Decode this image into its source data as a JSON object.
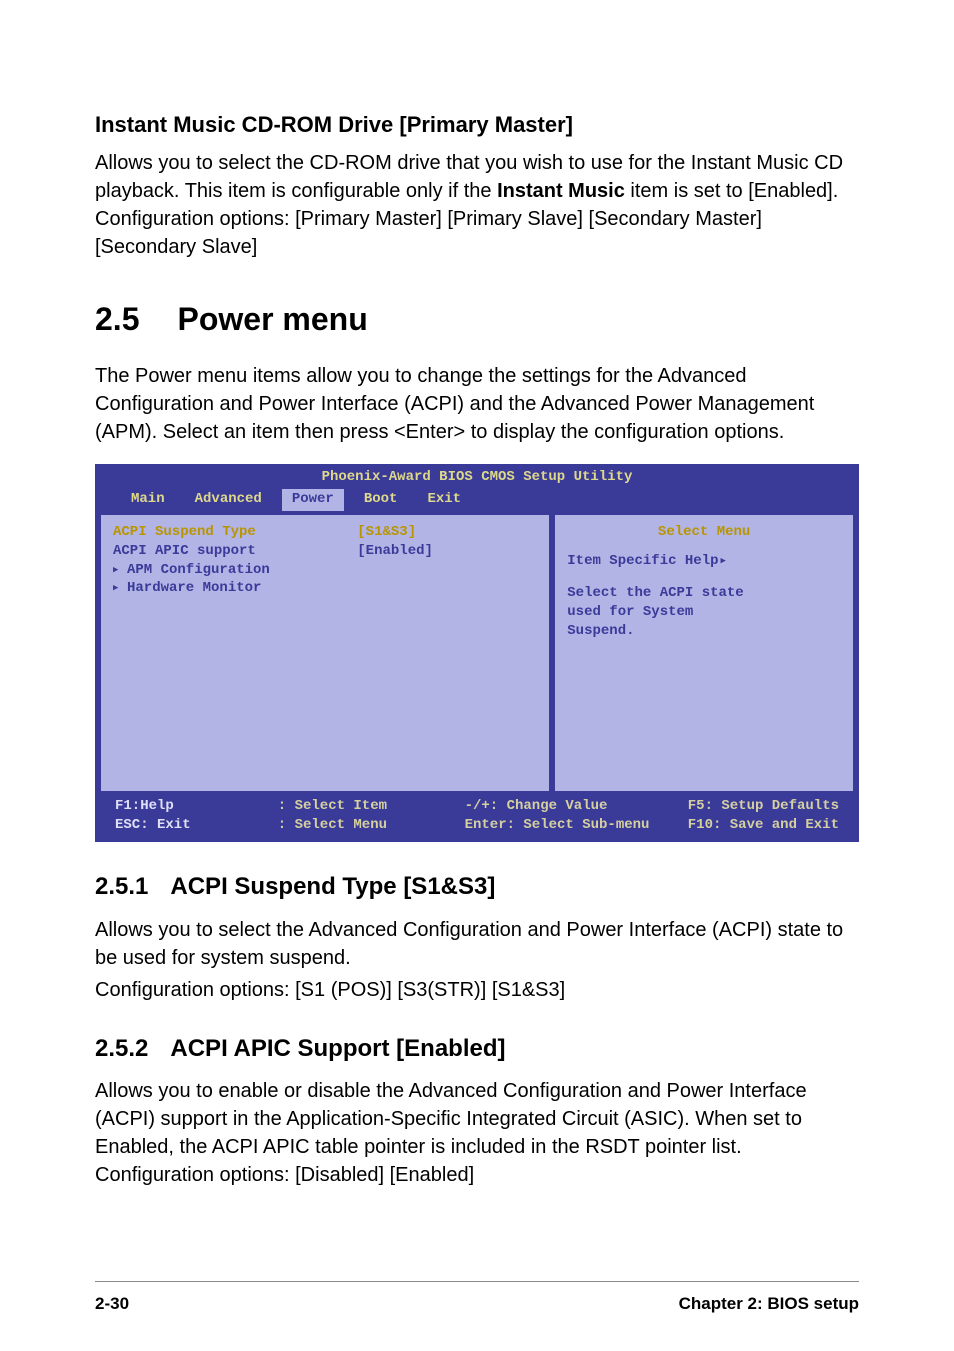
{
  "sec1": {
    "heading": "Instant Music CD-ROM Drive [Primary Master]",
    "text_a": "Allows you to select the CD-ROM drive that you wish to use for the Instant Music CD playback. This item is configurable only if the ",
    "text_bold": "Instant Music",
    "text_b": " item is set to [Enabled]. Configuration options: [Primary Master] [Primary Slave] [Secondary Master] [Secondary Slave]"
  },
  "sec2": {
    "num": "2.5",
    "title": "Power menu",
    "text": "The Power menu items allow you to change the settings for the Advanced Configuration and Power Interface (ACPI) and the Advanced Power Management (APM). Select an item then press <Enter> to display the configuration options."
  },
  "bios": {
    "title": "Phoenix-Award BIOS CMOS Setup Utility",
    "tabs": [
      "Main",
      "Advanced",
      "Power",
      "Boot",
      "Exit"
    ],
    "active_tab": "Power",
    "rows": [
      {
        "label": "ACPI Suspend Type",
        "value": "[S1&S3]",
        "selected": true,
        "sub": false
      },
      {
        "label": "ACPI APIC support",
        "value": "[Enabled]",
        "selected": false,
        "sub": false
      },
      {
        "label": "APM Configuration",
        "value": "",
        "selected": false,
        "sub": true
      },
      {
        "label": "Hardware Monitor",
        "value": "",
        "selected": false,
        "sub": true
      }
    ],
    "help_title": "Select Menu",
    "help_sub": "Item Specific Help",
    "help_text1": "Select the ACPI state",
    "help_text2": "used for System",
    "help_text3": "Suspend.",
    "footer": {
      "f1": "F1:Help",
      "esc": "ESC: Exit",
      "sel_item": ": Select Item",
      "sel_menu": ": Select Menu",
      "change": "-/+: Change Value",
      "enter": "Enter: Select Sub-menu",
      "f5": "F5: Setup Defaults",
      "f10": "F10: Save and Exit"
    }
  },
  "sec251": {
    "num": "2.5.1",
    "title": "ACPI Suspend Type [S1&S3]",
    "text1": "Allows you to select the Advanced Configuration and Power Interface (ACPI) state to be used for system suspend.",
    "text2": "Configuration options: [S1 (POS)] [S3(STR)] [S1&S3]"
  },
  "sec252": {
    "num": "2.5.2",
    "title": "ACPI APIC Support [Enabled]",
    "text": "Allows you to enable or disable the Advanced Configuration and Power Interface (ACPI) support in the Application-Specific Integrated Circuit (ASIC). When set to Enabled, the ACPI APIC table pointer is included in the RSDT pointer list. Configuration options: [Disabled] [Enabled]"
  },
  "footer": {
    "left": "2-30",
    "right": "Chapter 2: BIOS setup"
  }
}
